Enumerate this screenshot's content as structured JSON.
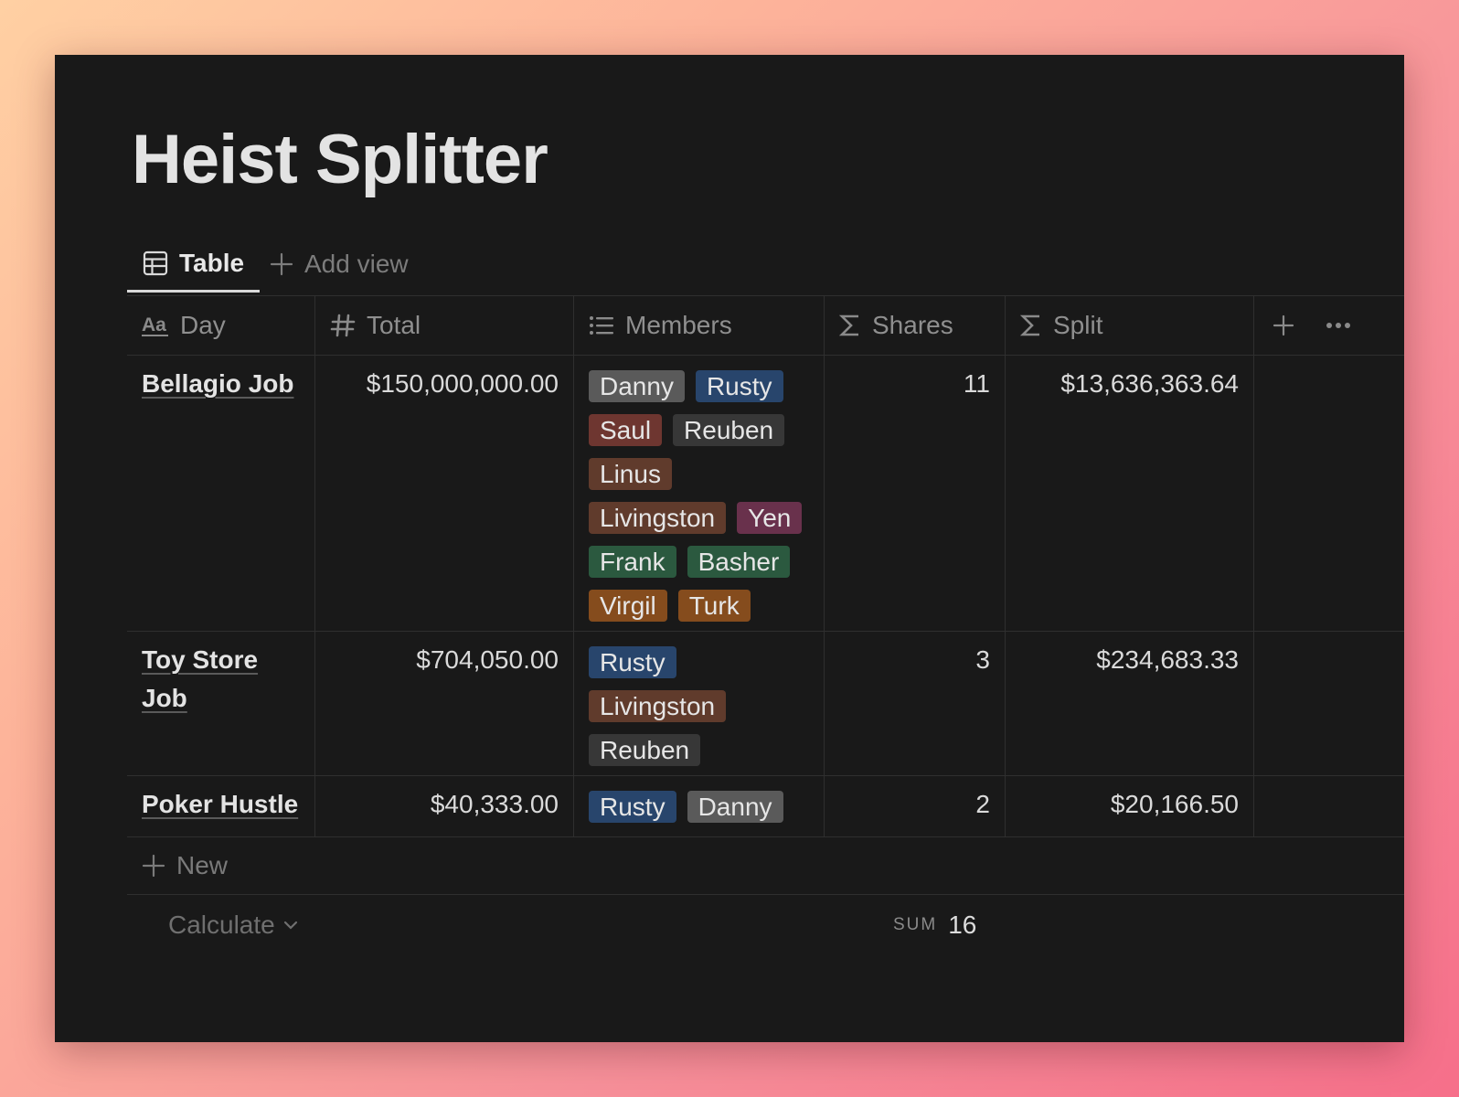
{
  "page": {
    "title": "Heist Splitter"
  },
  "views": {
    "active": "Table",
    "add_label": "Add view"
  },
  "columns": [
    {
      "label": "Day",
      "icon": "text-aa-icon"
    },
    {
      "label": "Total",
      "icon": "hash-icon"
    },
    {
      "label": "Members",
      "icon": "list-icon"
    },
    {
      "label": "Shares",
      "icon": "sigma-icon"
    },
    {
      "label": "Split",
      "icon": "sigma-icon"
    }
  ],
  "rows": [
    {
      "day": "Bellagio Job",
      "total": "$150,000,000.00",
      "members": [
        {
          "name": "Danny",
          "color": "#5a5a5a"
        },
        {
          "name": "Rusty",
          "color": "#28456c"
        },
        {
          "name": "Saul",
          "color": "#6e3630"
        },
        {
          "name": "Reuben",
          "color": "#373737"
        },
        {
          "name": "Linus",
          "color": "#603b2c"
        },
        {
          "name": "Livingston",
          "color": "#603b2c"
        },
        {
          "name": "Yen",
          "color": "#69314c"
        },
        {
          "name": "Frank",
          "color": "#2b593f"
        },
        {
          "name": "Basher",
          "color": "#2b593f"
        },
        {
          "name": "Virgil",
          "color": "#854c1d"
        },
        {
          "name": "Turk",
          "color": "#854c1d"
        }
      ],
      "shares": "11",
      "split": "$13,636,363.64"
    },
    {
      "day": "Toy Store Job",
      "total": "$704,050.00",
      "members": [
        {
          "name": "Rusty",
          "color": "#28456c"
        },
        {
          "name": "Livingston",
          "color": "#603b2c"
        },
        {
          "name": "Reuben",
          "color": "#373737"
        }
      ],
      "shares": "3",
      "split": "$234,683.33"
    },
    {
      "day": "Poker Hustle",
      "total": "$40,333.00",
      "members": [
        {
          "name": "Rusty",
          "color": "#28456c"
        },
        {
          "name": "Danny",
          "color": "#5a5a5a"
        }
      ],
      "shares": "2",
      "split": "$20,166.50"
    }
  ],
  "new_label": "New",
  "footer": {
    "calculate_label": "Calculate",
    "sum_label": "SUM",
    "sum_value": "16"
  }
}
